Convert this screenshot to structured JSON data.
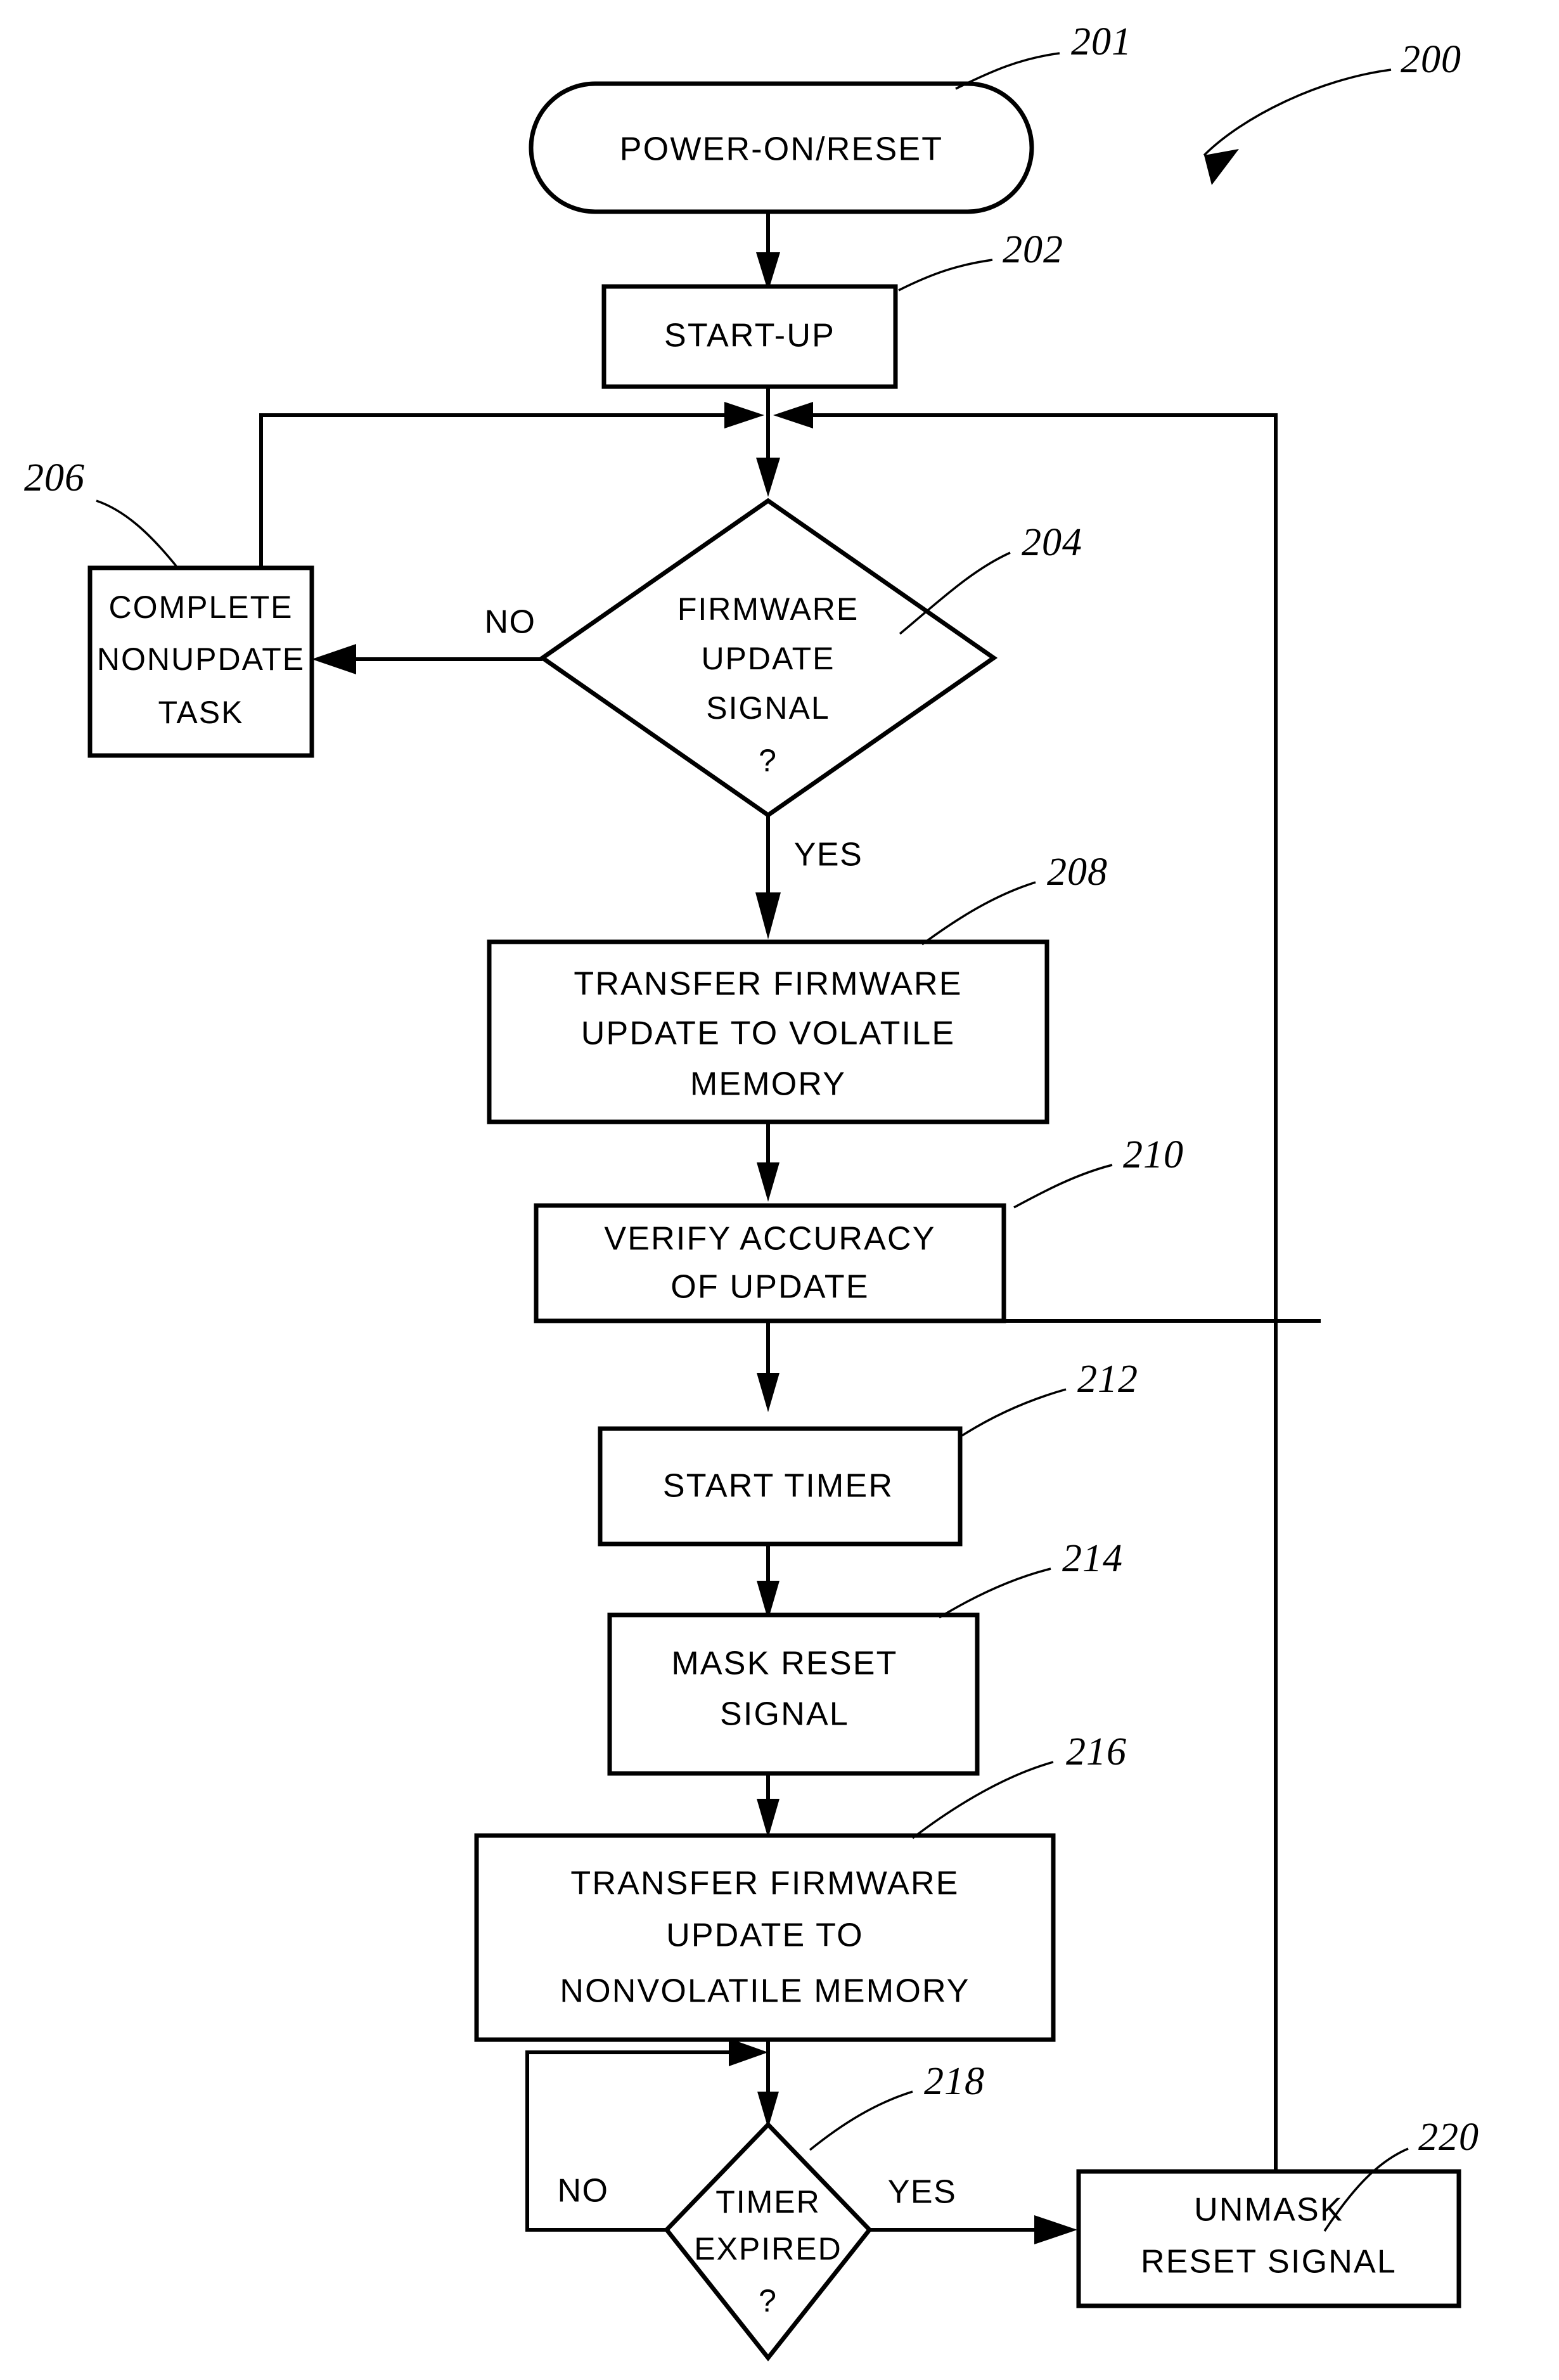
{
  "figure": {
    "label": "200",
    "type": "patent-flowchart",
    "title": "Firmware update process flowchart"
  },
  "nodes": [
    {
      "id": "n201",
      "ref": "201",
      "shape": "terminator",
      "lines": [
        "POWER-ON/RESET"
      ]
    },
    {
      "id": "n202",
      "ref": "202",
      "shape": "process",
      "lines": [
        "START-UP"
      ]
    },
    {
      "id": "n204",
      "ref": "204",
      "shape": "decision",
      "lines": [
        "FIRMWARE",
        "UPDATE",
        "SIGNAL",
        "?"
      ]
    },
    {
      "id": "n206",
      "ref": "206",
      "shape": "process",
      "lines": [
        "COMPLETE",
        "NONUPDATE",
        "TASK"
      ]
    },
    {
      "id": "n208",
      "ref": "208",
      "shape": "process",
      "lines": [
        "TRANSFER FIRMWARE",
        "UPDATE TO VOLATILE",
        "MEMORY"
      ]
    },
    {
      "id": "n210",
      "ref": "210",
      "shape": "process",
      "lines": [
        "VERIFY ACCURACY",
        "OF UPDATE"
      ]
    },
    {
      "id": "n212",
      "ref": "212",
      "shape": "process",
      "lines": [
        "START TIMER"
      ]
    },
    {
      "id": "n214",
      "ref": "214",
      "shape": "process",
      "lines": [
        "MASK RESET",
        "SIGNAL"
      ]
    },
    {
      "id": "n216",
      "ref": "216",
      "shape": "process",
      "lines": [
        "TRANSFER FIRMWARE",
        "UPDATE TO",
        "NONVOLATILE MEMORY"
      ]
    },
    {
      "id": "n218",
      "ref": "218",
      "shape": "decision",
      "lines": [
        "TIMER",
        "EXPIRED",
        "?"
      ]
    },
    {
      "id": "n220",
      "ref": "220",
      "shape": "process",
      "lines": [
        "UNMASK",
        "RESET SIGNAL"
      ]
    }
  ],
  "branch_labels": {
    "d204_no": "NO",
    "d204_yes": "YES",
    "d218_no": "NO",
    "d218_yes": "YES"
  },
  "colors": {
    "ink": "#000000",
    "paper": "#ffffff"
  }
}
